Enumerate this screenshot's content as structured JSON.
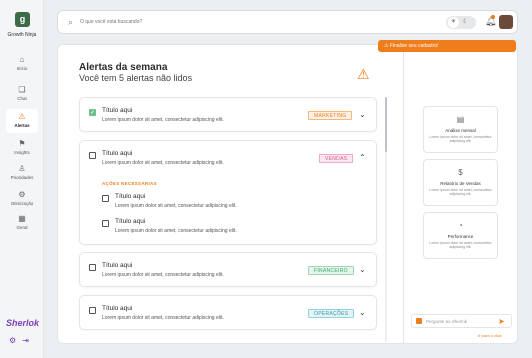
{
  "brand": {
    "name": "Growth Ninja",
    "logo_letter": "g"
  },
  "sidebar": {
    "items": [
      {
        "label": "Início",
        "icon": "⌂"
      },
      {
        "label": "Chat",
        "icon": "❏"
      },
      {
        "label": "Alertas",
        "icon": "⚠"
      },
      {
        "label": "Insights",
        "icon": "⚑"
      },
      {
        "label": "Prioridades",
        "icon": "♙"
      },
      {
        "label": "Otimização",
        "icon": "⚙"
      },
      {
        "label": "Geral",
        "icon": "▦"
      }
    ],
    "footer_brand": "Sherlok"
  },
  "search": {
    "placeholder": "O que você está buscando?"
  },
  "main": {
    "title": "Alertas da semana",
    "subtitle": "Você tem 5 alertas não lidos",
    "alerts": [
      {
        "title": "Título aqui",
        "desc": "Lorem ipsum dolor sit amet, consectetur adipiscing elit.",
        "tag": "MARKETING"
      },
      {
        "title": "Título aqui",
        "desc": "Lorem ipsum dolor sit amet, consectetur adipiscing elit.",
        "tag": "VENDAS",
        "actions_label": "AÇÕES NECESSÁRIAS",
        "actions": [
          {
            "title": "Título aqui",
            "desc": "Lorem ipsum dolor sit amet, consectetur adipiscing elit."
          },
          {
            "title": "Título aqui",
            "desc": "Lorem ipsum dolor sit amet, consectetur adipiscing elit."
          }
        ]
      },
      {
        "title": "Título aqui",
        "desc": "Lorem ipsum dolor sit amet, consectetur adipiscing elit.",
        "tag": "FINANCEIRO"
      },
      {
        "title": "Título aqui",
        "desc": "Lorem ipsum dolor sit amet, consectetur adipiscing elit.",
        "tag": "OPERAÇÕES"
      }
    ]
  },
  "right_panel": {
    "cta_label": "Finalize seu cadastro!",
    "cards": [
      {
        "title": "Análise mensal",
        "desc": "Lorem ipsum dolor sit amet, consectetur adipiscing elit."
      },
      {
        "title": "Relatório de Vendas",
        "desc": "Lorem ipsum dolor sit amet, consectetur adipiscing elit."
      },
      {
        "title": "Performance",
        "desc": "Lorem ipsum dolor sit amet, consectetur adipiscing elit."
      }
    ],
    "chat_placeholder": "Pergunte ao Sherlok",
    "chat_link": "Ir para o chat"
  },
  "colors": {
    "accent": "#f07d1b",
    "brand_green": "#3d6b48",
    "sherlok_purple": "#7a3fb6"
  }
}
